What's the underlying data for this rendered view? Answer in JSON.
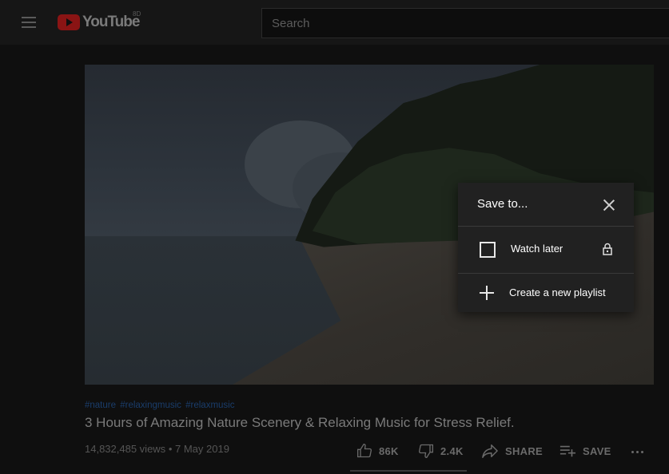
{
  "masthead": {
    "logo_text": "YouTube",
    "logo_superscript": "8D",
    "search_placeholder": "Search"
  },
  "video": {
    "hashtags": [
      "#nature",
      "#relaxingmusic",
      "#relaxmusic"
    ],
    "title": "3 Hours of Amazing Nature Scenery & Relaxing Music for Stress Relief.",
    "views": "14,832,485 views",
    "separator": "•",
    "date": "7 May 2019"
  },
  "actions": {
    "like_count": "86K",
    "dislike_count": "2.4K",
    "share_label": "SHARE",
    "save_label": "SAVE"
  },
  "save_dialog": {
    "title": "Save to...",
    "playlists": [
      {
        "label": "Watch later",
        "checked": false,
        "privacy": "lock-icon"
      }
    ],
    "create_label": "Create a new playlist"
  },
  "colors": {
    "brand_red": "#ff0000",
    "dialog_bg": "#212121",
    "hashtag_link": "#3ea6ff"
  }
}
